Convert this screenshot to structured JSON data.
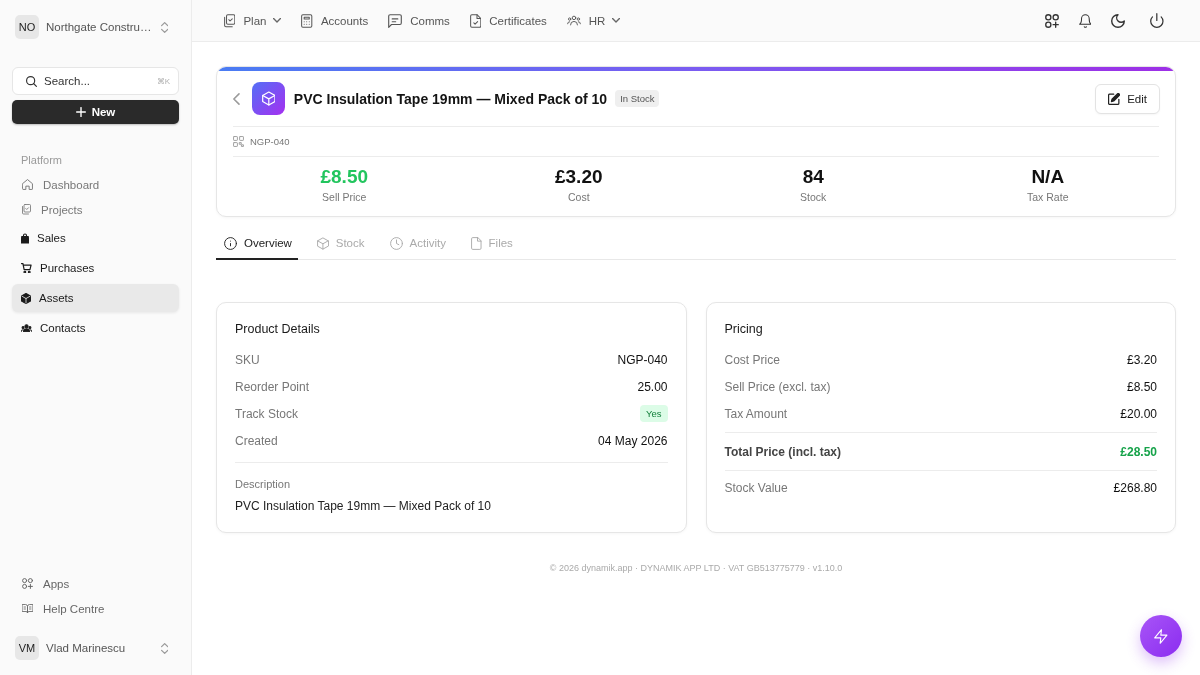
{
  "sidebar": {
    "workspace": {
      "initials": "NO",
      "name": "Northgate Constru…"
    },
    "search": {
      "placeholder": "Search...",
      "shortcut": "⌘K"
    },
    "new_button": "New",
    "section_label": "Platform",
    "items": [
      {
        "label": "Dashboard",
        "muted": true,
        "selected": false
      },
      {
        "label": "Projects",
        "muted": true,
        "selected": false
      },
      {
        "label": "Sales",
        "muted": false,
        "selected": false
      },
      {
        "label": "Purchases",
        "muted": false,
        "selected": false
      },
      {
        "label": "Assets",
        "muted": false,
        "selected": true
      },
      {
        "label": "Contacts",
        "muted": false,
        "selected": false
      }
    ],
    "footer_links": [
      {
        "label": "Apps"
      },
      {
        "label": "Help Centre"
      }
    ],
    "user": {
      "initials": "VM",
      "name": "Vlad Marinescu"
    }
  },
  "top_nav": {
    "items": [
      {
        "label": "Plan",
        "dropdown": true
      },
      {
        "label": "Accounts",
        "dropdown": false
      },
      {
        "label": "Comms",
        "dropdown": false
      },
      {
        "label": "Certificates",
        "dropdown": false
      },
      {
        "label": "HR",
        "dropdown": true
      }
    ]
  },
  "product": {
    "title": "PVC Insulation Tape 19mm — Mixed Pack of 10",
    "status": "In Stock",
    "edit_button": "Edit",
    "sku": "NGP-040",
    "stats": [
      {
        "value": "£8.50",
        "label": "Sell Price",
        "color": "#22c55e"
      },
      {
        "value": "£3.20",
        "label": "Cost",
        "color": "#111111"
      },
      {
        "value": "84",
        "label": "Stock",
        "color": "#111111"
      },
      {
        "value": "N/A",
        "label": "Tax Rate",
        "color": "#111111"
      }
    ]
  },
  "tabs": [
    {
      "label": "Overview",
      "selected": true
    },
    {
      "label": "Stock",
      "selected": false
    },
    {
      "label": "Activity",
      "selected": false
    },
    {
      "label": "Files",
      "selected": false
    }
  ],
  "details": {
    "title": "Product Details",
    "rows": [
      {
        "kind": "text",
        "label": "SKU",
        "value": "NGP-040"
      },
      {
        "kind": "text",
        "label": "Reorder Point",
        "value": "25.00"
      },
      {
        "kind": "badge",
        "label": "Track Stock",
        "value": "Yes"
      },
      {
        "kind": "text",
        "label": "Created",
        "value": "04 May 2026"
      }
    ],
    "description": {
      "label": "Description",
      "text": "PVC Insulation Tape 19mm — Mixed Pack of 10"
    }
  },
  "pricing": {
    "title": "Pricing",
    "rows": [
      {
        "kind": "text",
        "label": "Cost Price",
        "value": "£3.20"
      },
      {
        "kind": "text",
        "label": "Sell Price (excl. tax)",
        "value": "£8.50"
      },
      {
        "kind": "text",
        "label": "Tax Amount",
        "value": "£20.00"
      },
      {
        "kind": "total",
        "label": "Total Price (incl. tax)",
        "value": "£28.50"
      },
      {
        "kind": "text",
        "label": "Stock Value",
        "value": "£268.80"
      }
    ]
  },
  "footer": "© 2026 dynamik.app · DYNAMIK APP LTD · VAT GB513775779 · v1.10.0"
}
